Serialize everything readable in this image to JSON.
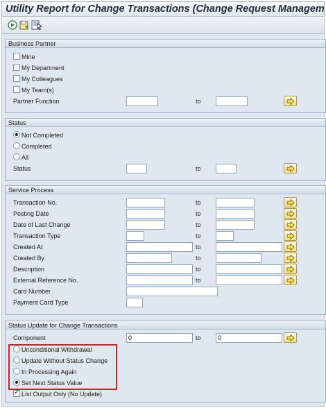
{
  "title": "Utility Report for Change Transactions (Change Request Management)",
  "toolbar": {
    "icons": [
      "execute-icon",
      "save-variant-icon",
      "variant-select-icon"
    ]
  },
  "business_partner": {
    "header": "Business Partner",
    "checkboxes": [
      {
        "label": "Mine",
        "checked": false
      },
      {
        "label": "My Department",
        "checked": false
      },
      {
        "label": "My Colleagues",
        "checked": false
      },
      {
        "label": "My Team(s)",
        "checked": false
      }
    ],
    "partner_function": {
      "label": "Partner Function",
      "to": "to",
      "from_value": "",
      "to_value": ""
    }
  },
  "status": {
    "header": "Status",
    "radios": [
      {
        "label": "Not Completed",
        "selected": true
      },
      {
        "label": "Completed",
        "selected": false
      },
      {
        "label": "All",
        "selected": false
      }
    ],
    "status_field": {
      "label": "Status",
      "to": "to",
      "from_value": "",
      "to_value": ""
    }
  },
  "service_process": {
    "header": "Service Process",
    "fields": [
      {
        "label": "Transaction No.",
        "to": "to"
      },
      {
        "label": "Posting Date",
        "to": "to"
      },
      {
        "label": "Date of Last Change",
        "to": "to"
      },
      {
        "label": "Transaction Type",
        "to": "to"
      },
      {
        "label": "Created At",
        "to": "to"
      },
      {
        "label": "Created By",
        "to": "to"
      },
      {
        "label": "Description",
        "to": "to"
      },
      {
        "label": "External Reference No.",
        "to": "to"
      },
      {
        "label": "Card Number"
      },
      {
        "label": "Payment Card Type"
      }
    ]
  },
  "status_update": {
    "header": "Status Update for Change Transactions",
    "component": {
      "label": "Component",
      "to": "to",
      "from_value": "0",
      "to_value": "0"
    },
    "radios": [
      {
        "label": "Unconditional Withdrawal",
        "selected": false
      },
      {
        "label": "Update Without Status Change",
        "selected": false
      },
      {
        "label": "In Processing Again",
        "selected": false
      },
      {
        "label": "Set Next Status Value",
        "selected": true
      }
    ],
    "list_output": {
      "label": "List Output Only (No Update)",
      "checked": true
    }
  },
  "colors": {
    "highlight": "#c0282a",
    "group_bg": "#dfe8f1",
    "button": "#f2df8a"
  }
}
